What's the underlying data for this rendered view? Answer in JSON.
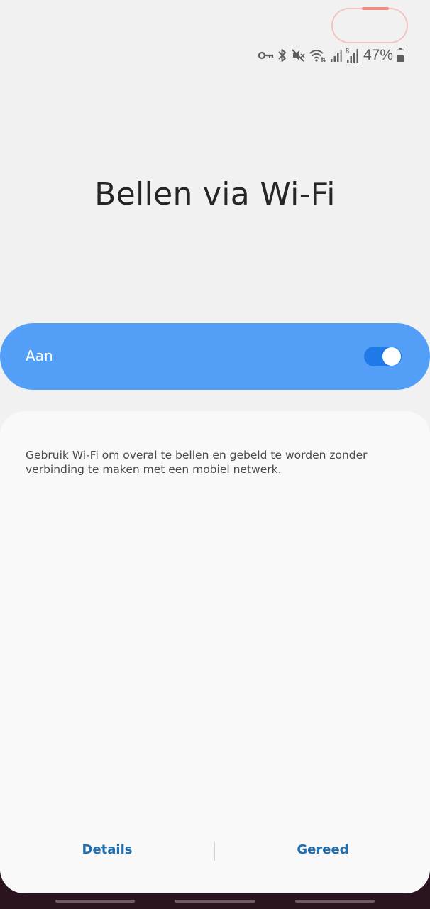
{
  "status_bar": {
    "battery_percent": "47%",
    "icons": [
      "vpn-key-icon",
      "bluetooth-icon",
      "mute-icon",
      "wifi-calling-icon",
      "signal-icon",
      "signal-roaming-icon",
      "battery-icon"
    ]
  },
  "page": {
    "title": "Bellen via Wi-Fi"
  },
  "master_switch": {
    "label": "Aan",
    "enabled": true
  },
  "card": {
    "description": "Gebruik Wi-Fi om overal te bellen en gebeld te worden zonder verbinding te maken met een mobiel netwerk."
  },
  "footer": {
    "details_label": "Details",
    "done_label": "Gereed"
  },
  "colors": {
    "accent": "#539ff7",
    "toggle_track": "#1f7ae8",
    "button_text": "#1f6fb3",
    "background": "#f1f1f1"
  }
}
